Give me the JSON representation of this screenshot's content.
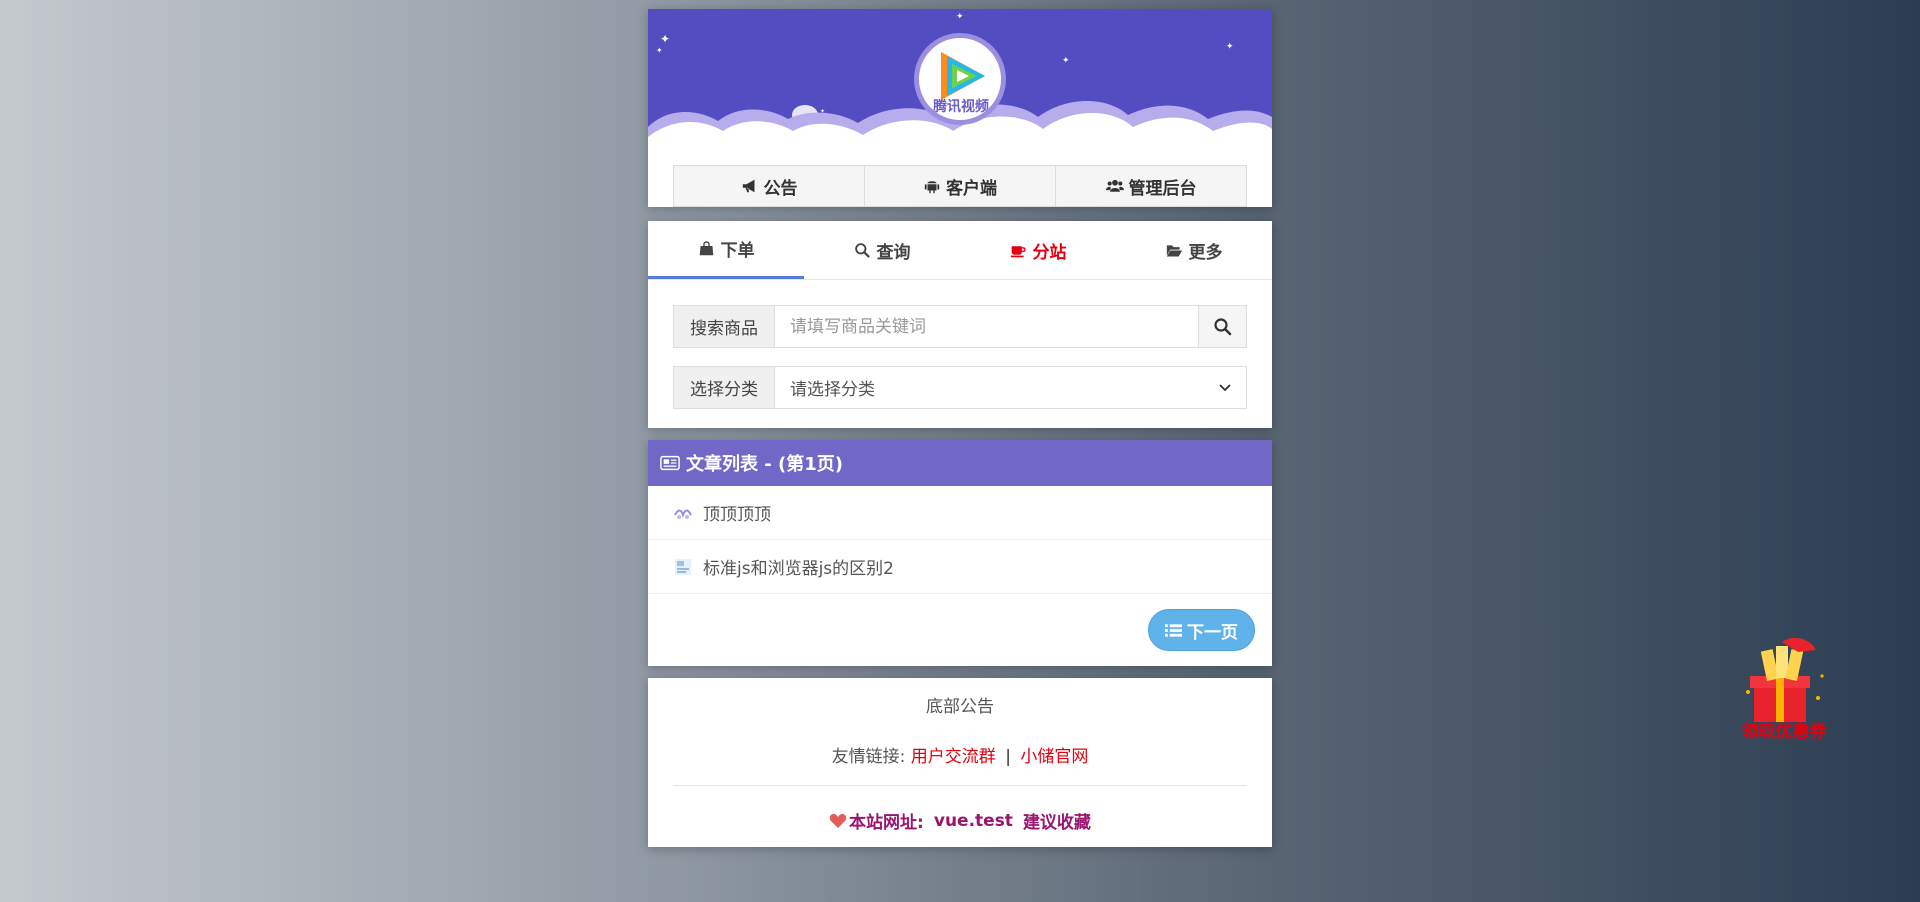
{
  "header": {
    "logo_text": "腾讯视频",
    "nav": [
      {
        "label": "公告",
        "icon": "megaphone-icon"
      },
      {
        "label": "客户端",
        "icon": "android-icon"
      },
      {
        "label": "管理后台",
        "icon": "users-icon"
      }
    ],
    "banner_color": "#544dc2"
  },
  "tabs": [
    {
      "label": "下单",
      "icon": "shopping-bag-icon",
      "active": true
    },
    {
      "label": "查询",
      "icon": "search-icon"
    },
    {
      "label": "分站",
      "icon": "coffee-cup-icon",
      "color": "#e4000f"
    },
    {
      "label": "更多",
      "icon": "folder-open-icon"
    }
  ],
  "search": {
    "addon_label": "搜索商品",
    "placeholder": "请填写商品关键词",
    "value": ""
  },
  "category": {
    "addon_label": "选择分类",
    "selected": "请选择分类"
  },
  "articles": {
    "title": "文章列表 - (第1页)",
    "items": [
      {
        "title": "顶顶顶顶"
      },
      {
        "title": "标准js和浏览器js的区别2"
      }
    ],
    "next_label": "下一页",
    "header_color": "#7067c6"
  },
  "footer": {
    "notice": "底部公告",
    "links_label": "友情链接:",
    "links": [
      "用户交流群",
      "小储官网"
    ],
    "separator": "|",
    "site_label": "本站网址:",
    "site_domain": "vue.test",
    "site_tip": "建议收藏"
  },
  "float_gift": {
    "label": "领取优惠券"
  }
}
